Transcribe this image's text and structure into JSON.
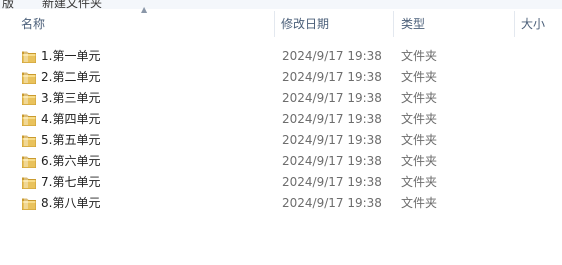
{
  "breadcrumb": {
    "left": "版",
    "title": "新建文件夹"
  },
  "columns": {
    "name": "名称",
    "date": "修改日期",
    "type": "类型",
    "size": "大小"
  },
  "files": [
    {
      "name": "1.第一单元",
      "date": "2024/9/17 19:38",
      "type": "文件夹",
      "icon": "folder-icon"
    },
    {
      "name": "2.第二单元",
      "date": "2024/9/17 19:38",
      "type": "文件夹",
      "icon": "folder-icon"
    },
    {
      "name": "3.第三单元",
      "date": "2024/9/17 19:38",
      "type": "文件夹",
      "icon": "folder-icon"
    },
    {
      "name": "4.第四单元",
      "date": "2024/9/17 19:38",
      "type": "文件夹",
      "icon": "folder-icon"
    },
    {
      "name": "5.第五单元",
      "date": "2024/9/17 19:38",
      "type": "文件夹",
      "icon": "folder-icon"
    },
    {
      "name": "6.第六单元",
      "date": "2024/9/17 19:38",
      "type": "文件夹",
      "icon": "folder-icon"
    },
    {
      "name": "7.第七单元",
      "date": "2024/9/17 19:38",
      "type": "文件夹",
      "icon": "folder-icon"
    },
    {
      "name": "8.第八单元",
      "date": "2024/9/17 19:38",
      "type": "文件夹",
      "icon": "folder-icon"
    }
  ],
  "colors": {
    "header_text": "#4c607a",
    "folder_body": "#e9c25c",
    "folder_light": "#f7dc8a",
    "folder_edge": "#c99a2e"
  }
}
